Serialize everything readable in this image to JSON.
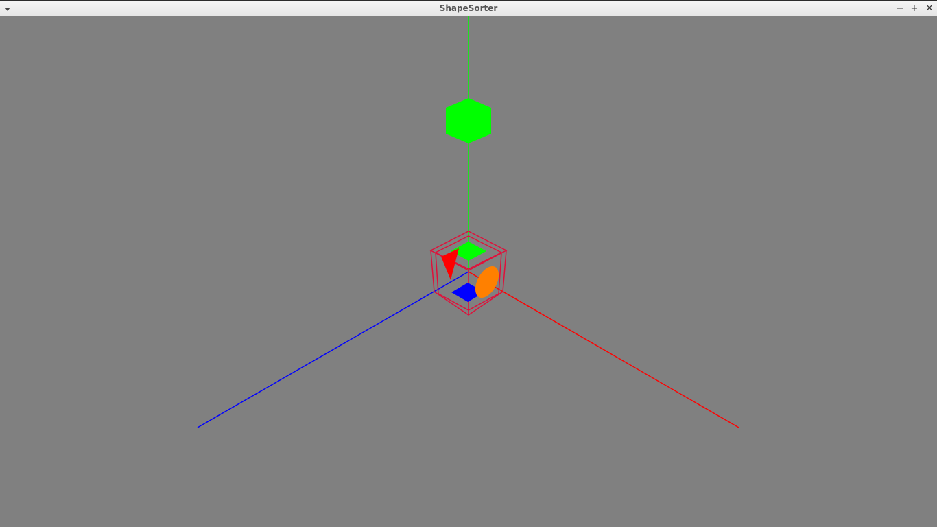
{
  "window": {
    "title": "ShapeSorter",
    "menu_icon": "chevron-down-icon",
    "minimize_glyph": "−",
    "maximize_glyph": "+",
    "close_glyph": "✕"
  },
  "scene": {
    "background_color": "#808080",
    "axes": {
      "x_color": "#ff0000",
      "y_color": "#00ff00",
      "z_color": "#0000ff"
    },
    "held_shape": {
      "shape": "cube",
      "color": "#00ff00"
    },
    "sorter_box": {
      "frame_color": "#e0103a",
      "holes": [
        {
          "shape": "square",
          "color": "#00ff00"
        },
        {
          "shape": "triangle",
          "color": "#ff0000"
        },
        {
          "shape": "square",
          "color": "#0000ff"
        },
        {
          "shape": "circle",
          "color": "#ff8000"
        }
      ]
    }
  }
}
